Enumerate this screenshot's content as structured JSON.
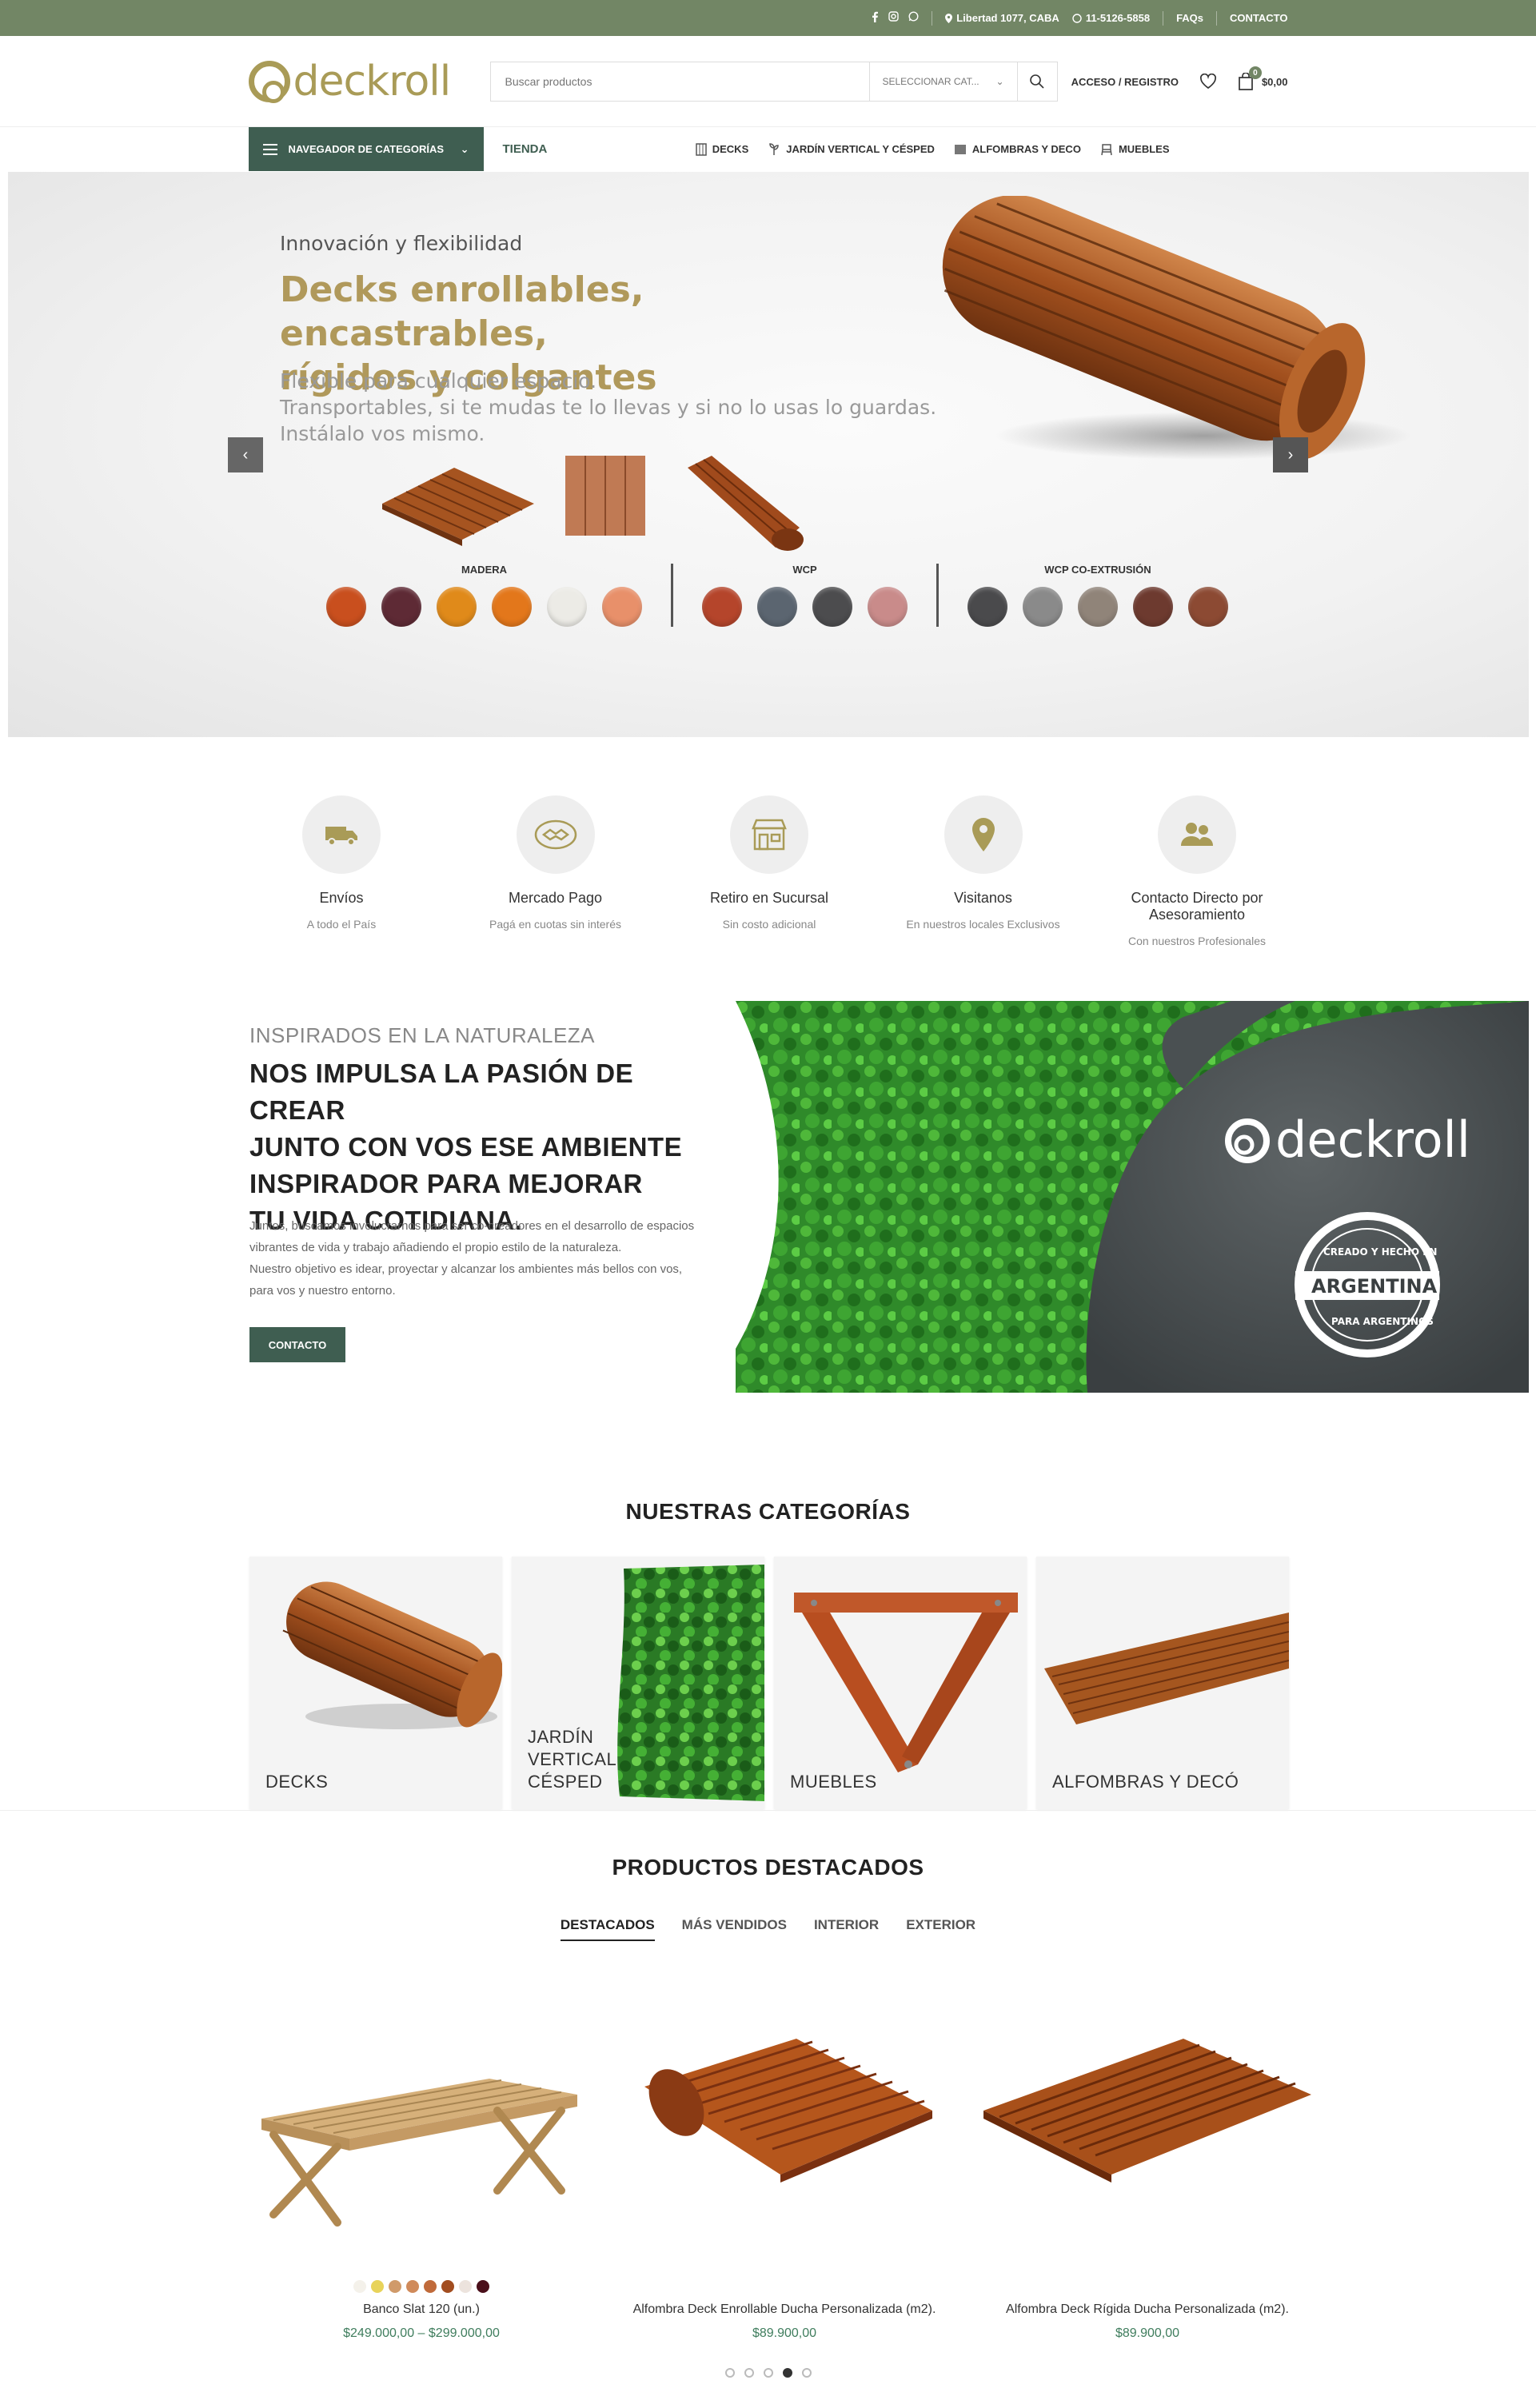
{
  "topbar": {
    "address": "Libertad 1077, CABA",
    "phone": "11-5126-5858",
    "faqs": "FAQs",
    "contact": "CONTACTO",
    "social_icons": [
      "facebook-icon",
      "instagram-icon",
      "whatsapp-icon"
    ]
  },
  "header": {
    "logo_text": "deckroll",
    "search_placeholder": "Buscar productos",
    "category_select": "SELECCIONAR CAT...",
    "account": "ACCESO / REGISTRO",
    "cart_count": "0",
    "cart_total": "$0,00"
  },
  "nav": {
    "categories_button": "NAVEGADOR DE CATEGORÍAS",
    "tienda": "TIENDA",
    "links": [
      "DECKS",
      "JARDÍN VERTICAL Y CÉSPED",
      "ALFOMBRAS Y DECO",
      "MUEBLES"
    ]
  },
  "hero": {
    "subtitle": "Innovación y flexibilidad",
    "title_line1": "Decks enrollables, encastrables,",
    "title_line2": "rígidos y colgantes",
    "desc_line1": "Flexible para cualquier espacio.",
    "desc_line2": "Transportables, si te mudas te lo llevas y si no lo usas lo guardas.",
    "desc_line3": "Instálalo vos mismo.",
    "swatch_groups": [
      {
        "label": "MADERA",
        "colors": [
          "#c94f1e",
          "#5e2a35",
          "#e08a1a",
          "#e3771b",
          "#ecebe6",
          "#e8906a"
        ]
      },
      {
        "label": "WCP",
        "colors": [
          "#b5452b",
          "#5b6570",
          "#4c4c4e",
          "#c98b8a"
        ]
      },
      {
        "label": "WCP CO-EXTRUSIÓN",
        "colors": [
          "#4a4a4c",
          "#8a8a8a",
          "#908479",
          "#6d3a2f",
          "#8c4a33"
        ]
      }
    ]
  },
  "features": [
    {
      "title": "Envíos",
      "desc": "A todo el País",
      "icon": "truck-icon"
    },
    {
      "title": "Mercado Pago",
      "desc": "Pagá en cuotas sin interés",
      "icon": "handshake-icon"
    },
    {
      "title": "Retiro en Sucursal",
      "desc": "Sin costo adicional",
      "icon": "store-icon"
    },
    {
      "title": "Visitanos",
      "desc": "En nuestros locales Exclusivos",
      "icon": "location-icon"
    },
    {
      "title": "Contacto Directo por Asesoramiento",
      "desc": "Con nuestros Profesionales",
      "icon": "users-icon"
    }
  ],
  "about": {
    "kicker": "INSPIRADOS EN LA NATURALEZA",
    "heading_line1": "NOS IMPULSA LA PASIÓN DE CREAR",
    "heading_line2": "JUNTO CON VOS ESE AMBIENTE",
    "heading_line3": "INSPIRADOR PARA MEJORAR",
    "heading_line4": "TU VIDA COTIDIANA.",
    "p_line1": "Juntos, buscamos involucrarnos para ser co-creadores en el desarrollo de espacios",
    "p_line2": "vibrantes de vida y trabajo añadiendo el propio estilo de la naturaleza.",
    "p_line3": "Nuestro objetivo es idear, proyectar y alcanzar los ambientes más bellos con vos,",
    "p_line4": "para vos y nuestro entorno.",
    "button": "CONTACTO",
    "shirt_logo": "deckroll",
    "badge_top": "CREADO Y HECHO EN",
    "badge_mid": "ARGENTINA",
    "badge_bottom": "PARA ARGENTINOS"
  },
  "categories": {
    "title": "NUESTRAS CATEGORÍAS",
    "items": [
      "DECKS",
      "JARDÍN VERTICAL Y CÉSPED",
      "MUEBLES",
      "ALFOMBRAS Y DECÓ"
    ]
  },
  "products": {
    "title": "PRODUCTOS DESTACADOS",
    "tabs": [
      "DESTACADOS",
      "MÁS VENDIDOS",
      "INTERIOR",
      "EXTERIOR"
    ],
    "items": [
      {
        "name": "Banco Slat 120 (un.)",
        "price": "$249.000,00 – $299.000,00",
        "colors": [
          "#f4f1ea",
          "#e8d35a",
          "#d09a6a",
          "#d08a5a",
          "#c06a3a",
          "#a24d20",
          "#ece3dd",
          "#4a0f1a"
        ]
      },
      {
        "name": "Alfombra Deck Enrollable Ducha Personalizada (m2).",
        "price": "$89.900,00",
        "colors": []
      },
      {
        "name": "Alfombra Deck Rígida Ducha Personalizada (m2).",
        "price": "$89.900,00",
        "colors": []
      }
    ],
    "pagination_count": 5,
    "pagination_active": 4
  }
}
